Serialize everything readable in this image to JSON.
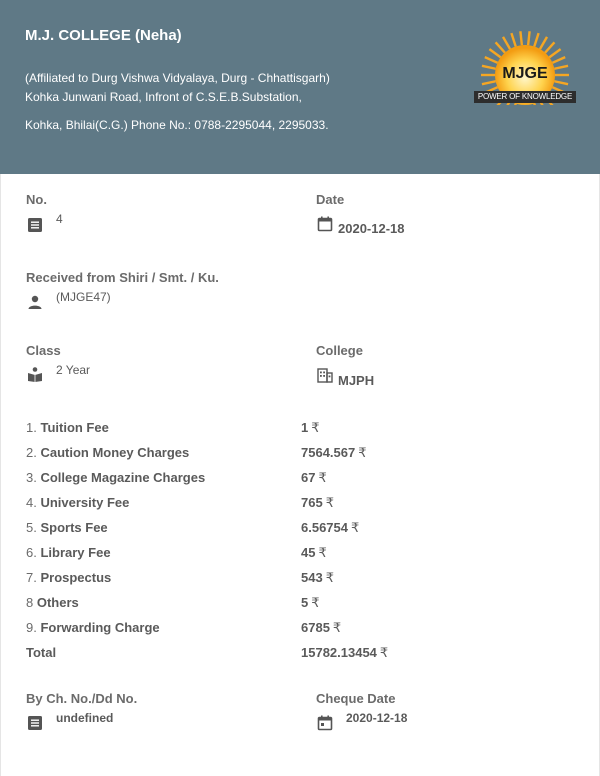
{
  "header": {
    "college_name": "M.J. COLLEGE (Neha)",
    "affiliation": "(Affiliated to Durg Vishwa Vidyalaya, Durg - Chhattisgarh)",
    "address_line1": "Kohka Junwani Road, Infront of C.S.E.B.Substation,",
    "address_line2": "Kohka, Bhilai(C.G.) Phone No.: 0788-2295044, 2295033.",
    "logo_text": "MJGE",
    "logo_tagline": "POWER OF KNOWLEDGE"
  },
  "receipt": {
    "no_label": "No.",
    "no_value": "4",
    "date_label": "Date",
    "date_value": "2020-12-18",
    "received_label": "Received from Shiri / Smt. / Ku.",
    "received_value": "(MJGE47)",
    "class_label": "Class",
    "class_value": "2 Year",
    "college_label": "College",
    "college_value": "MJPH",
    "currency_symbol": "₹",
    "fees": [
      {
        "num": "1.",
        "name": "Tuition Fee",
        "amount": "1"
      },
      {
        "num": "2.",
        "name": "Caution Money Charges",
        "amount": "7564.567"
      },
      {
        "num": "3.",
        "name": "College Magazine Charges",
        "amount": "67"
      },
      {
        "num": "4.",
        "name": "University Fee",
        "amount": "765"
      },
      {
        "num": "5.",
        "name": "Sports Fee",
        "amount": "6.56754"
      },
      {
        "num": "6.",
        "name": "Library Fee",
        "amount": "45"
      },
      {
        "num": "7.",
        "name": "Prospectus",
        "amount": "543"
      },
      {
        "num": "8",
        "name": "Others",
        "amount": "5"
      },
      {
        "num": "9.",
        "name": "Forwarding Charge",
        "amount": "6785"
      }
    ],
    "total_label": "Total",
    "total_value": "15782.13454",
    "cheque_no_label": "By Ch. No./Dd No.",
    "cheque_no_value": "undefined",
    "cheque_date_label": "Cheque Date",
    "cheque_date_value": "2020-12-18"
  },
  "colors": {
    "header_bg": "#5f7986",
    "logo_sun": "#f5a623"
  }
}
